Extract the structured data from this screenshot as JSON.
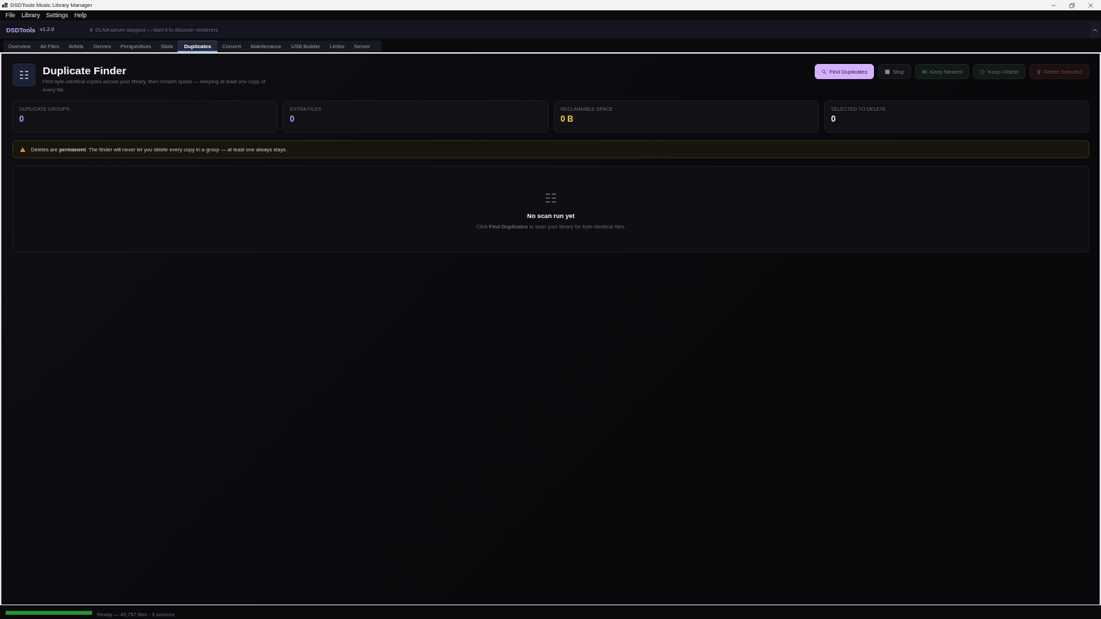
{
  "window": {
    "title": "DSDTools Music Library Manager"
  },
  "menu": [
    "File",
    "Library",
    "Settings",
    "Help"
  ],
  "header": {
    "brand": "DSDTools",
    "version": "v1.2.0",
    "status": "DLNA server stopped — start it to discover renderers"
  },
  "tabs": [
    {
      "label": "Overview",
      "selected": false
    },
    {
      "label": "All Files",
      "selected": false
    },
    {
      "label": "Artists",
      "selected": false
    },
    {
      "label": "Genres",
      "selected": false
    },
    {
      "label": "Perspectives",
      "selected": false
    },
    {
      "label": "Stats",
      "selected": false
    },
    {
      "label": "Duplicates",
      "selected": true
    },
    {
      "label": "Convert",
      "selected": false
    },
    {
      "label": "Maintenance",
      "selected": false
    },
    {
      "label": "USB Builder",
      "selected": false
    },
    {
      "label": "Limbo",
      "selected": false
    },
    {
      "label": "Server",
      "selected": false
    }
  ],
  "page": {
    "title": "Duplicate Finder",
    "subtitle": "Find byte-identical copies across your library, then reclaim space — keeping at least one copy of every file.",
    "actions": [
      {
        "label": "Find Duplicates",
        "kind": "primary",
        "disabled": false
      },
      {
        "label": "Stop",
        "kind": "neutral",
        "disabled": true
      },
      {
        "label": "Keep Newest",
        "kind": "positive",
        "disabled": true
      },
      {
        "label": "Keep Oldest",
        "kind": "positive",
        "disabled": true
      },
      {
        "label": "Delete Selected",
        "kind": "danger",
        "disabled": true
      }
    ]
  },
  "stats": [
    {
      "label": "DUPLICATE GROUPS",
      "value": "0",
      "color": "#b79df7"
    },
    {
      "label": "EXTRA FILES",
      "value": "0",
      "color": "#b79df7"
    },
    {
      "label": "RECLAIMABLE SPACE",
      "value": "0 B",
      "color": "#f6c945"
    },
    {
      "label": "SELECTED TO DELETE",
      "value": "0",
      "color": "#f2f2f4"
    }
  ],
  "warning": {
    "text": "Deletes are **permanent**. The finder will never let you delete every copy in a group — at least one always stays."
  },
  "empty_state": {
    "title": "No scan run yet",
    "text": "Click **Find Duplicates** to scan your library for byte-identical files."
  },
  "status_bar": {
    "level": 1,
    "text": "Ready — 49,757 files · 3 sources"
  }
}
